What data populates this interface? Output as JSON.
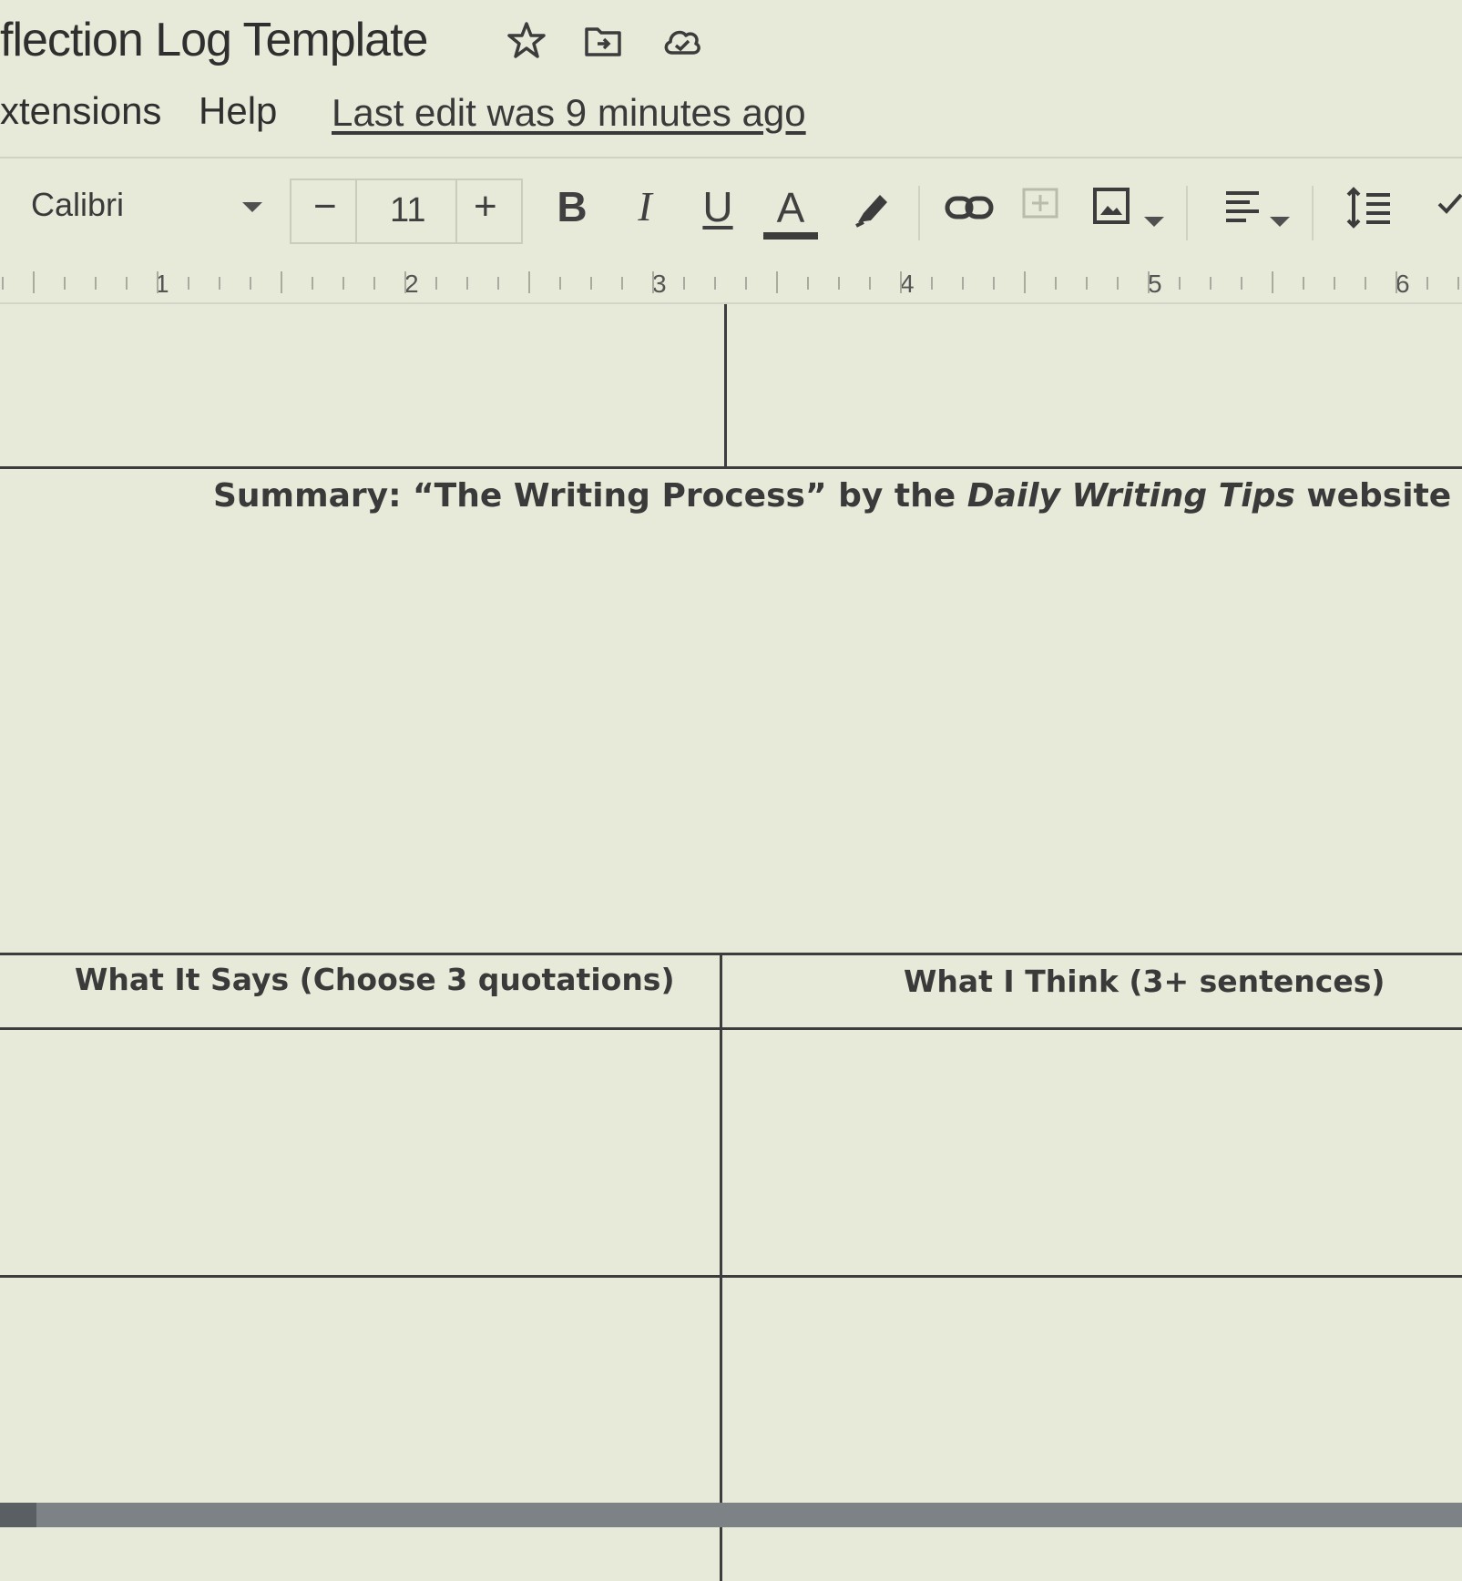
{
  "titlebar": {
    "doc_title": "flection Log Template",
    "icons": [
      "star-icon",
      "move-to-folder-icon",
      "cloud-status-icon"
    ]
  },
  "menubar": {
    "items": [
      "xtensions",
      "Help"
    ],
    "last_edit": "Last edit was 9 minutes ago"
  },
  "toolbar": {
    "font_name": "Calibri",
    "font_size": "11",
    "decrease_label": "−",
    "increase_label": "+",
    "bold_label": "B",
    "italic_label": "I",
    "underline_label": "U",
    "text_color_label": "A",
    "icons": [
      "highlight-pen-icon",
      "insert-link-icon",
      "add-comment-icon",
      "insert-image-icon",
      "align-icon",
      "line-spacing-icon",
      "checklist-icon"
    ]
  },
  "ruler": {
    "labels": [
      "1",
      "2",
      "3",
      "4",
      "5",
      "6"
    ]
  },
  "document": {
    "summary_prefix": "Summary: “The Writing Process” by the ",
    "summary_italic": "Daily Writing Tips",
    "summary_suffix": " website",
    "col_left_header": "What It Says (Choose 3 quotations)",
    "col_right_header": "What I Think (3+ sentences)"
  }
}
